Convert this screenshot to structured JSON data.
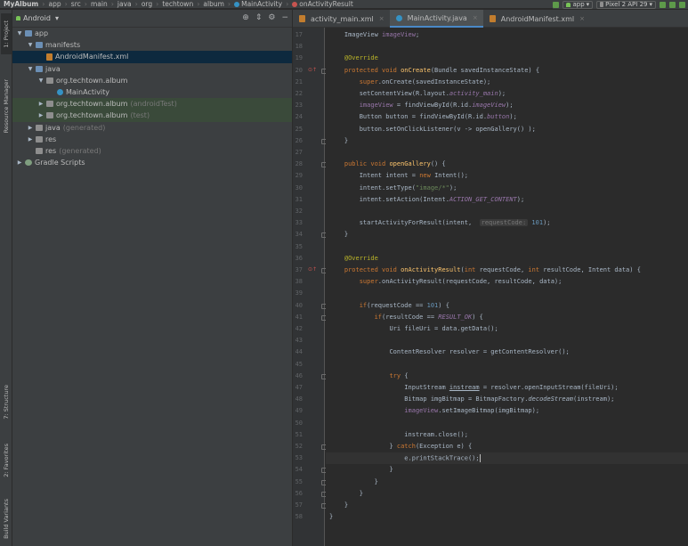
{
  "breadcrumbs": [
    "MyAlbum",
    "app",
    "src",
    "main",
    "java",
    "org",
    "techtown",
    "album",
    "MainActivity",
    "onActivityResult"
  ],
  "toolbar": {
    "run_config": "app",
    "device": "Pixel 2 API 29"
  },
  "side_tabs": [
    "1: Project",
    "Resource Manager",
    "7: Structure",
    "2: Favorites",
    "Build Variants"
  ],
  "project_panel": {
    "view_mode": "Android",
    "tree": [
      {
        "label": "app",
        "extra": "",
        "depth": 0,
        "arrow": "open",
        "icon": "folder-blue"
      },
      {
        "label": "manifests",
        "extra": "",
        "depth": 1,
        "arrow": "open",
        "icon": "folder-blue"
      },
      {
        "label": "AndroidManifest.xml",
        "extra": "",
        "depth": 2,
        "arrow": "",
        "icon": "xml"
      },
      {
        "label": "java",
        "extra": "",
        "depth": 1,
        "arrow": "open",
        "icon": "folder-blue"
      },
      {
        "label": "org.techtown.album",
        "extra": "",
        "depth": 2,
        "arrow": "open",
        "icon": "folder"
      },
      {
        "label": "MainActivity",
        "extra": "",
        "depth": 3,
        "arrow": "",
        "icon": "cls"
      },
      {
        "label": "org.techtown.album",
        "extra": "(androidTest)",
        "depth": 2,
        "arrow": "closed",
        "icon": "folder"
      },
      {
        "label": "org.techtown.album",
        "extra": "(test)",
        "depth": 2,
        "arrow": "closed",
        "icon": "folder"
      },
      {
        "label": "java",
        "extra": "(generated)",
        "depth": 1,
        "arrow": "closed",
        "icon": "folder"
      },
      {
        "label": "res",
        "extra": "",
        "depth": 1,
        "arrow": "closed",
        "icon": "folder"
      },
      {
        "label": "res",
        "extra": "(generated)",
        "depth": 1,
        "arrow": "",
        "icon": "folder"
      },
      {
        "label": "Gradle Scripts",
        "extra": "",
        "depth": 0,
        "arrow": "closed",
        "icon": "gradle"
      }
    ]
  },
  "tabs": [
    {
      "label": "activity_main.xml",
      "icon": "xml"
    },
    {
      "label": "MainActivity.java",
      "icon": "cls"
    },
    {
      "label": "AndroidManifest.xml",
      "icon": "xml"
    }
  ],
  "editor": {
    "first_line": 17,
    "last_line": 58,
    "current_line": 53,
    "lines": {
      "17": "    ImageView imageView;",
      "18": "",
      "19": "    @Override",
      "20": "    protected void onCreate(Bundle savedInstanceState) {",
      "21": "        super.onCreate(savedInstanceState);",
      "22": "        setContentView(R.layout.activity_main);",
      "23": "        imageView = findViewById(R.id.imageView);",
      "24": "        Button button = findViewById(R.id.button);",
      "25": "        button.setOnClickListener(v -> openGallery() );",
      "26": "    }",
      "27": "",
      "28": "    public void openGallery() {",
      "29": "        Intent intent = new Intent();",
      "30": "        intent.setType(\"image/*\");",
      "31": "        intent.setAction(Intent.ACTION_GET_CONTENT);",
      "32": "",
      "33": "        startActivityForResult(intent,  requestCode: 101);",
      "34": "    }",
      "35": "",
      "36": "    @Override",
      "37": "    protected void onActivityResult(int requestCode, int resultCode, Intent data) {",
      "38": "        super.onActivityResult(requestCode, resultCode, data);",
      "39": "",
      "40": "        if(requestCode == 101) {",
      "41": "            if(resultCode == RESULT_OK) {",
      "42": "                Uri fileUri = data.getData();",
      "43": "",
      "44": "                ContentResolver resolver = getContentResolver();",
      "45": "",
      "46": "                try {",
      "47": "                    InputStream instream = resolver.openInputStream(fileUri);",
      "48": "                    Bitmap imgBitmap = BitmapFactory.decodeStream(instream);",
      "49": "                    imageView.setImageBitmap(imgBitmap);",
      "50": "",
      "51": "                    instream.close();",
      "52": "                } catch(Exception e) {",
      "53": "                    e.printStackTrace();",
      "54": "                }",
      "55": "            }",
      "56": "        }",
      "57": "    }",
      "58": "}"
    },
    "override_markers": [
      20,
      37
    ],
    "fold_markers": [
      20,
      26,
      28,
      34,
      37,
      40,
      41,
      46,
      52,
      54,
      55,
      56,
      57
    ]
  },
  "colors": {
    "background": "#2b2b2b",
    "panel": "#3c3f41",
    "keyword": "#cc7832",
    "annotation": "#bbb529",
    "method": "#ffc66d",
    "field": "#9876aa",
    "number": "#6897bb",
    "string": "#6a8759",
    "selection": "#0d293e"
  }
}
